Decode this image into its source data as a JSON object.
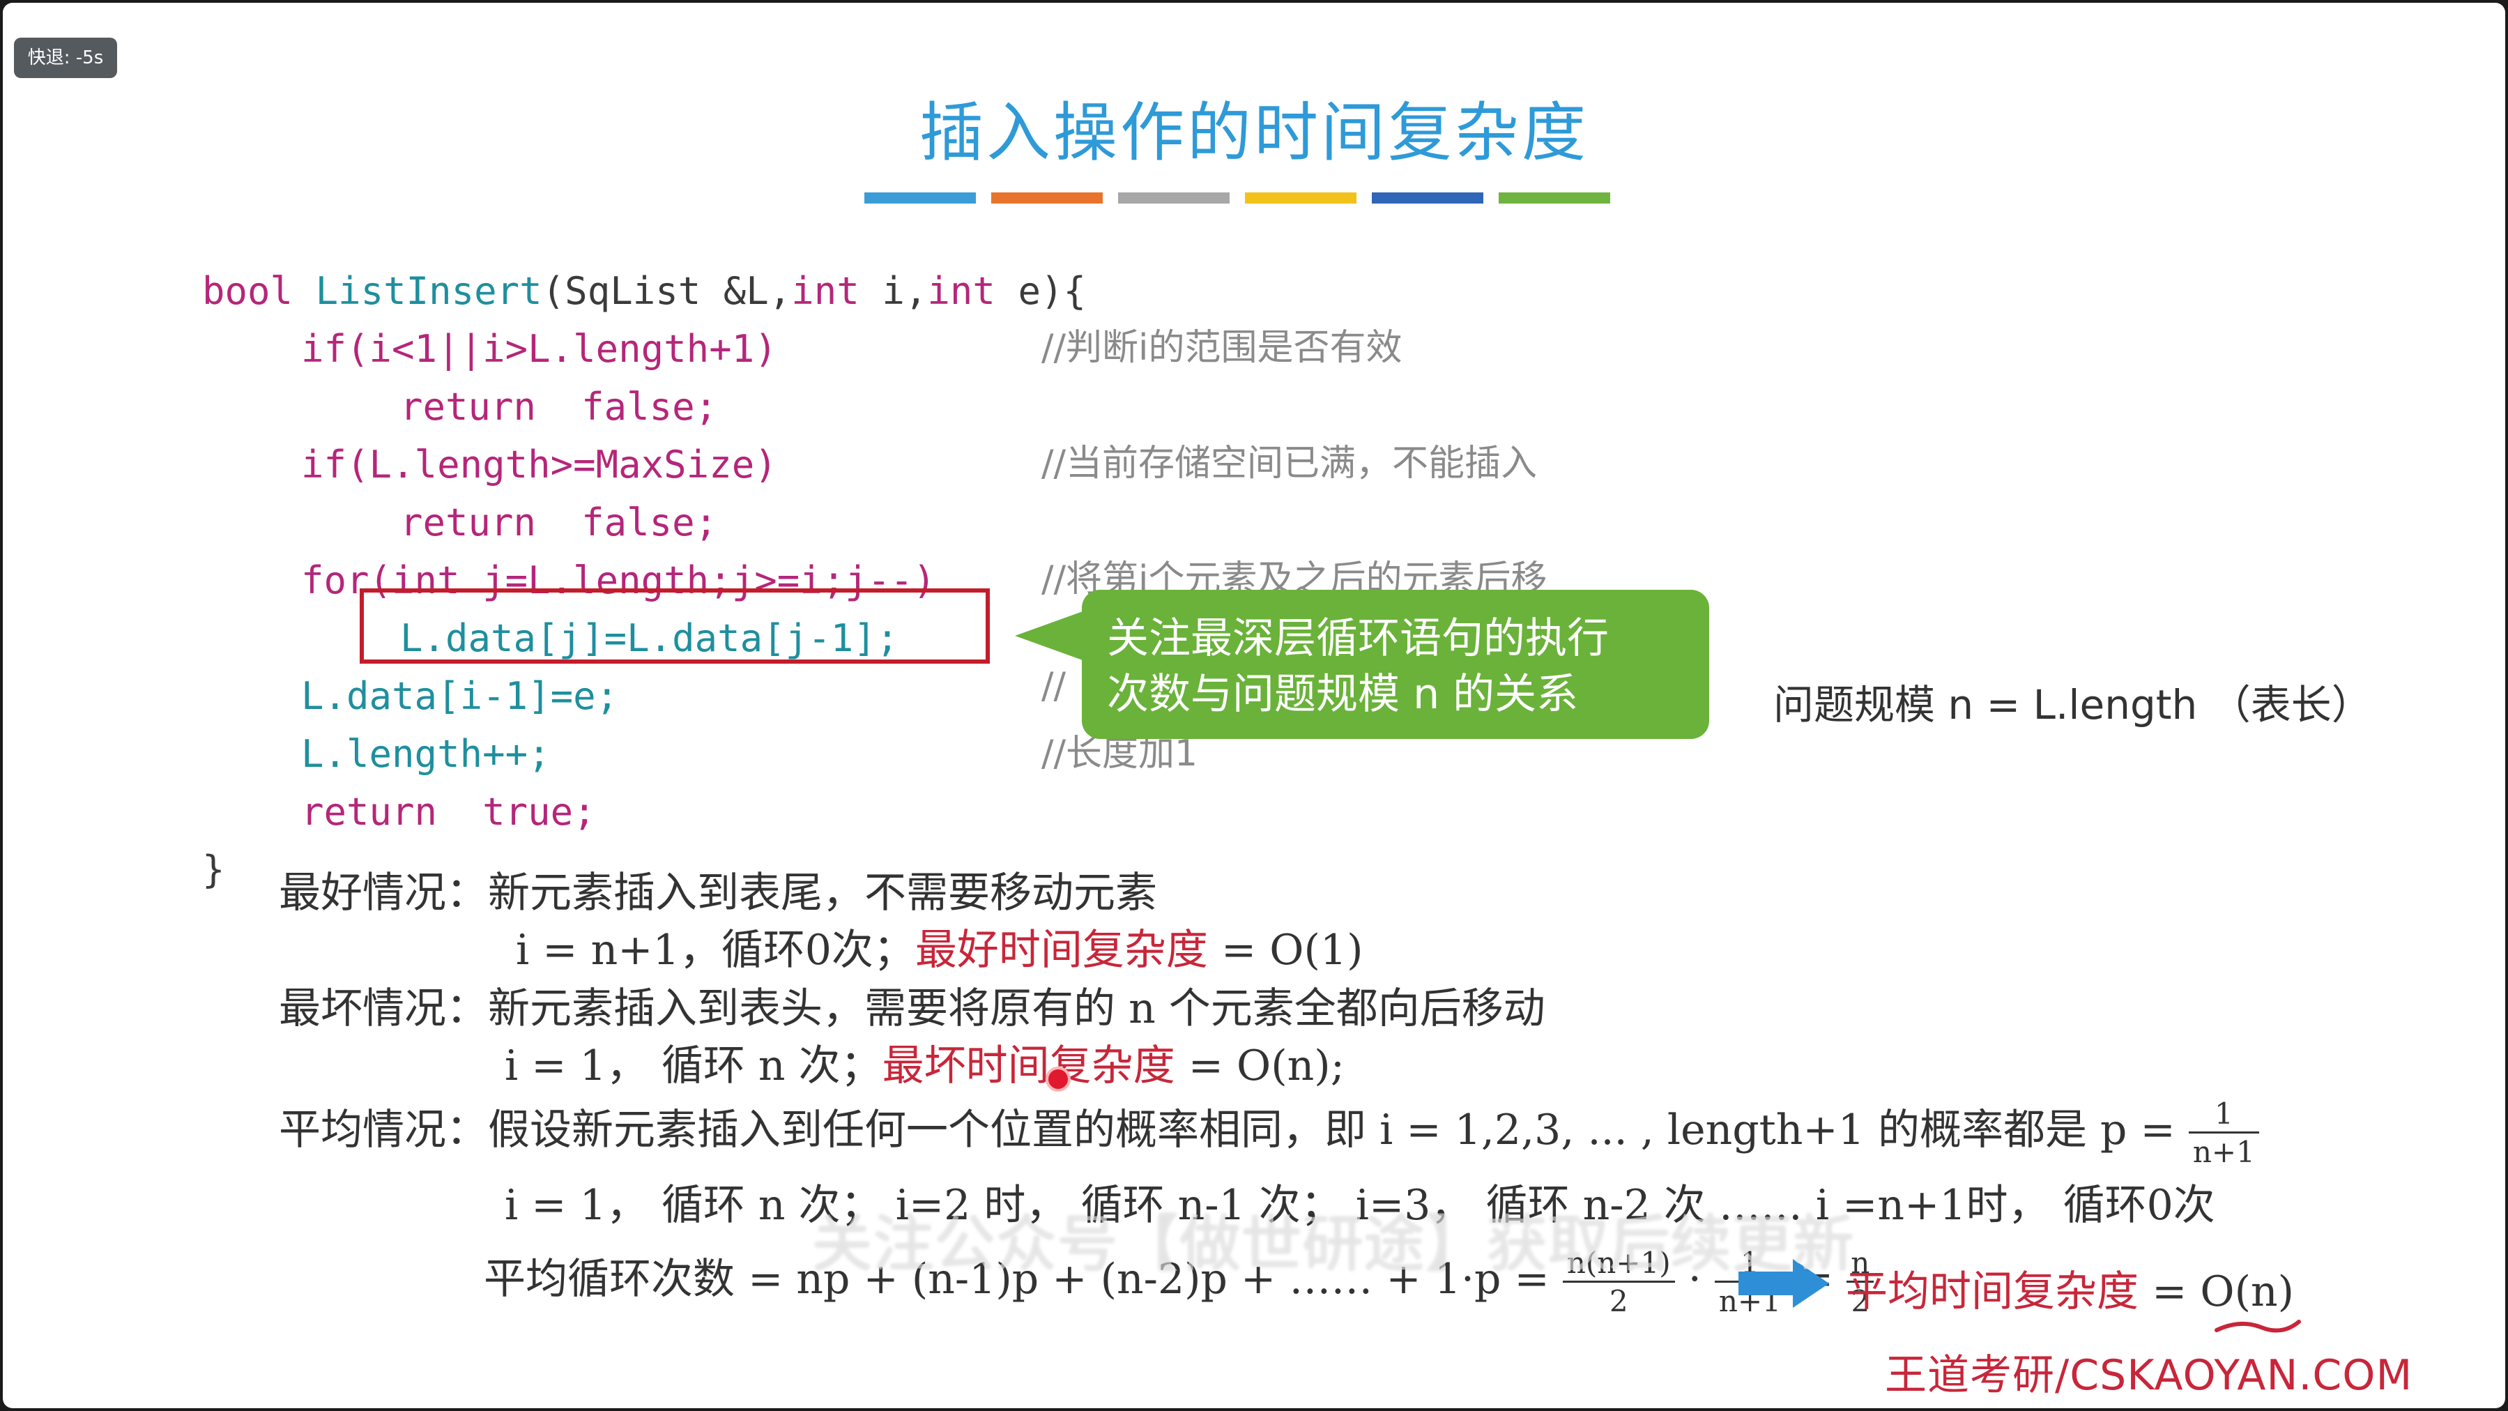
{
  "badge": "快退: -5s",
  "title": "插入操作的时间复杂度",
  "bar_colors": [
    "#3a9dd8",
    "#e8742c",
    "#a7a7a7",
    "#f2c21b",
    "#2f66b8",
    "#6fb43f"
  ],
  "code": {
    "l1_kw": "bool",
    "l1_fn": "ListInsert",
    "l1_rest": "(SqList &L,",
    "l1_kw2": "int",
    "l1_rest2": " i,",
    "l1_kw3": "int",
    "l1_rest3": " e){",
    "l2": "if(i<1||i>L.length+1)",
    "l3": "return  false;",
    "l4": "if(L.length>=MaxSize)",
    "l5": "return  false;",
    "l6": "for(int j=L.length;j>=i;j--)",
    "l7": "L.data[j]=L.data[j-1];",
    "l8": "L.data[i-1]=e;",
    "l9": "L.length++;",
    "l10": "return  true;",
    "l11": "}"
  },
  "comments": {
    "c1": "//判断i的范围是否有效",
    "c2": "//当前存储空间已满，不能插入",
    "c3": "//将第i个元素及之后的元素后移",
    "c4": "//",
    "c5": "//长度加1"
  },
  "callout": {
    "line1": "关注最深层循环语句的执行",
    "line2": "次数与问题规模 n 的关系"
  },
  "problem_scale": "问题规模 n = L.length （表长）",
  "best": {
    "label": "最好情况：",
    "desc": "新元素插入到表尾，不需要移动元素",
    "detail": "i = n+1，循环0次；",
    "complexity_label": "最好时间复杂度",
    "complexity": " = O(1)"
  },
  "worst": {
    "label": "最坏情况：",
    "desc": "新元素插入到表头，需要将原有的 n 个元素全都向后移动",
    "detail": "i = 1，  循环 n 次；",
    "complexity_label": "最坏时间复杂度",
    "complexity": " = O(n);"
  },
  "avg": {
    "label": "平均情况：",
    "desc": "假设新元素插入到任何一个位置的概率相同，即 i = 1,2,3, ... , length+1 的概率都是 p =",
    "p_num": "1",
    "p_den": "n+1",
    "detail": "i = 1，  循环 n 次；  i=2 时，  循环 n-1 次；  i=3，  循环 n-2 次 ……  i =n+1时，  循环0次",
    "sum_label": "平均循环次数 = np + (n-1)p + (n-2)p + …… + 1·p =",
    "f1_num": "n(n+1)",
    "f1_den": "2",
    "f2_num": "1",
    "f2_den": "n+1",
    "eq": "=",
    "f3_num": "n",
    "f3_den": "2",
    "result_label": "平均时间复杂度",
    "result": " = O(n)"
  },
  "watermark": "关注公众号【做世研途】获取后续更新",
  "brand": "王道考研/CSKAOYAN.COM"
}
